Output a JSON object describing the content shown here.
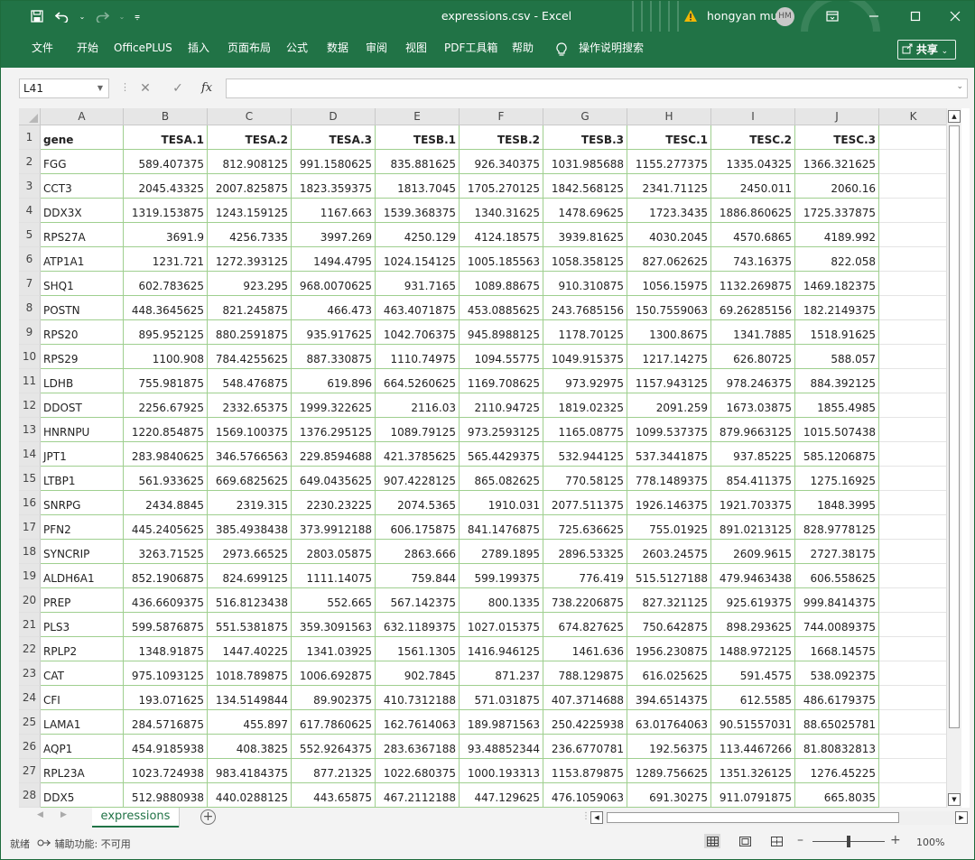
{
  "window": {
    "title": "expressions.csv - Excel",
    "user_name": "hongyan mu",
    "avatar_initials": "HM"
  },
  "ribbon": {
    "tabs": [
      "文件",
      "开始",
      "OfficePLUS",
      "插入",
      "页面布局",
      "公式",
      "数据",
      "审阅",
      "视图",
      "PDF工具箱",
      "帮助"
    ],
    "tell_me": "操作说明搜索",
    "share_label": "共享"
  },
  "formula_bar": {
    "name_box": "L41",
    "fx_label": "fx",
    "formula": ""
  },
  "sheet": {
    "columns": [
      "A",
      "B",
      "C",
      "D",
      "E",
      "F",
      "G",
      "H",
      "I",
      "J",
      "K"
    ],
    "row_numbers": [
      "1",
      "2",
      "3",
      "4",
      "5",
      "6",
      "7",
      "8",
      "9",
      "10",
      "11",
      "12",
      "13",
      "14",
      "15",
      "16",
      "17",
      "18",
      "19",
      "20",
      "21",
      "22",
      "23",
      "24",
      "25",
      "26",
      "27",
      "28"
    ],
    "header_row": [
      "gene",
      "TESA.1",
      "TESA.2",
      "TESA.3",
      "TESB.1",
      "TESB.2",
      "TESB.3",
      "TESC.1",
      "TESC.2",
      "TESC.3"
    ],
    "rows": [
      [
        "FGG",
        "589.407375",
        "812.908125",
        "991.1580625",
        "835.881625",
        "926.340375",
        "1031.985688",
        "1155.277375",
        "1335.04325",
        "1366.321625"
      ],
      [
        "CCT3",
        "2045.43325",
        "2007.825875",
        "1823.359375",
        "1813.7045",
        "1705.270125",
        "1842.568125",
        "2341.71125",
        "2450.011",
        "2060.16"
      ],
      [
        "DDX3X",
        "1319.153875",
        "1243.159125",
        "1167.663",
        "1539.368375",
        "1340.31625",
        "1478.69625",
        "1723.3435",
        "1886.860625",
        "1725.337875"
      ],
      [
        "RPS27A",
        "3691.9",
        "4256.7335",
        "3997.269",
        "4250.129",
        "4124.18575",
        "3939.81625",
        "4030.2045",
        "4570.6865",
        "4189.992"
      ],
      [
        "ATP1A1",
        "1231.721",
        "1272.393125",
        "1494.4795",
        "1024.154125",
        "1005.185563",
        "1058.358125",
        "827.062625",
        "743.16375",
        "822.058"
      ],
      [
        "SHQ1",
        "602.783625",
        "923.295",
        "968.0070625",
        "931.7165",
        "1089.88675",
        "910.310875",
        "1056.15975",
        "1132.269875",
        "1469.182375"
      ],
      [
        "POSTN",
        "448.3645625",
        "821.245875",
        "466.473",
        "463.4071875",
        "453.0885625",
        "243.7685156",
        "150.7559063",
        "69.26285156",
        "182.2149375"
      ],
      [
        "RPS20",
        "895.952125",
        "880.2591875",
        "935.917625",
        "1042.706375",
        "945.8988125",
        "1178.70125",
        "1300.8675",
        "1341.7885",
        "1518.91625"
      ],
      [
        "RPS29",
        "1100.908",
        "784.4255625",
        "887.330875",
        "1110.74975",
        "1094.55775",
        "1049.915375",
        "1217.14275",
        "626.80725",
        "588.057"
      ],
      [
        "LDHB",
        "755.981875",
        "548.476875",
        "619.896",
        "664.5260625",
        "1169.708625",
        "973.92975",
        "1157.943125",
        "978.246375",
        "884.392125"
      ],
      [
        "DDOST",
        "2256.67925",
        "2332.65375",
        "1999.322625",
        "2116.03",
        "2110.94725",
        "1819.02325",
        "2091.259",
        "1673.03875",
        "1855.4985"
      ],
      [
        "HNRNPU",
        "1220.854875",
        "1569.100375",
        "1376.295125",
        "1089.79125",
        "973.2593125",
        "1165.08775",
        "1099.537375",
        "879.9663125",
        "1015.507438"
      ],
      [
        "JPT1",
        "283.9840625",
        "346.5766563",
        "229.8594688",
        "421.3785625",
        "565.4429375",
        "532.944125",
        "537.3441875",
        "937.85225",
        "585.1206875"
      ],
      [
        "LTBP1",
        "561.933625",
        "669.6825625",
        "649.0435625",
        "907.4228125",
        "865.082625",
        "770.58125",
        "778.1489375",
        "854.411375",
        "1275.16925"
      ],
      [
        "SNRPG",
        "2434.8845",
        "2319.315",
        "2230.23225",
        "2074.5365",
        "1910.031",
        "2077.511375",
        "1926.146375",
        "1921.703375",
        "1848.3995"
      ],
      [
        "PFN2",
        "445.2405625",
        "385.4938438",
        "373.9912188",
        "606.175875",
        "841.1476875",
        "725.636625",
        "755.01925",
        "891.0213125",
        "828.9778125"
      ],
      [
        "SYNCRIP",
        "3263.71525",
        "2973.66525",
        "2803.05875",
        "2863.666",
        "2789.1895",
        "2896.53325",
        "2603.24575",
        "2609.9615",
        "2727.38175"
      ],
      [
        "ALDH6A1",
        "852.1906875",
        "824.699125",
        "1111.14075",
        "759.844",
        "599.199375",
        "776.419",
        "515.5127188",
        "479.9463438",
        "606.558625"
      ],
      [
        "PREP",
        "436.6609375",
        "516.8123438",
        "552.665",
        "567.142375",
        "800.1335",
        "738.2206875",
        "827.321125",
        "925.619375",
        "999.8414375"
      ],
      [
        "PLS3",
        "599.5876875",
        "551.5381875",
        "359.3091563",
        "632.1189375",
        "1027.015375",
        "674.827625",
        "750.642875",
        "898.293625",
        "744.0089375"
      ],
      [
        "RPLP2",
        "1348.91875",
        "1447.40225",
        "1341.03925",
        "1561.1305",
        "1416.946125",
        "1461.636",
        "1956.230875",
        "1488.972125",
        "1668.14575"
      ],
      [
        "CAT",
        "975.1093125",
        "1018.789875",
        "1006.692875",
        "902.7845",
        "871.237",
        "788.129875",
        "616.025625",
        "591.4575",
        "538.092375"
      ],
      [
        "CFI",
        "193.071625",
        "134.5149844",
        "89.902375",
        "410.7312188",
        "571.031875",
        "407.3714688",
        "394.6514375",
        "612.5585",
        "486.6179375"
      ],
      [
        "LAMA1",
        "284.5716875",
        "455.897",
        "617.7860625",
        "162.7614063",
        "189.9871563",
        "250.4225938",
        "63.01764063",
        "90.51557031",
        "88.65025781"
      ],
      [
        "AQP1",
        "454.9185938",
        "408.3825",
        "552.9264375",
        "283.6367188",
        "93.48852344",
        "236.6770781",
        "192.56375",
        "113.4467266",
        "81.80832813"
      ],
      [
        "RPL23A",
        "1023.724938",
        "983.4184375",
        "877.21325",
        "1022.680375",
        "1000.193313",
        "1153.879875",
        "1289.756625",
        "1351.326125",
        "1276.45225"
      ],
      [
        "DDX5",
        "512.9880938",
        "440.0288125",
        "443.65875",
        "467.2112188",
        "447.129625",
        "476.1059063",
        "691.30275",
        "911.0791875",
        "665.8035"
      ]
    ]
  },
  "sheet_tabs": {
    "active": "expressions"
  },
  "status_bar": {
    "ready": "就绪",
    "accessibility": "辅助功能: 不可用",
    "zoom": "100%"
  },
  "colors": {
    "excel_green": "#217346",
    "grid_line": "#9fcf8f"
  },
  "icons": [
    "save-icon",
    "undo-icon",
    "redo-icon",
    "customize-qat-icon",
    "warning-icon",
    "ribbon-display-icon",
    "minimize-icon",
    "maximize-icon",
    "close-icon",
    "lightbulb-icon",
    "share-icon",
    "cancel-icon",
    "enter-icon",
    "add-sheet-icon",
    "normal-view-icon",
    "page-layout-icon",
    "page-break-icon"
  ]
}
